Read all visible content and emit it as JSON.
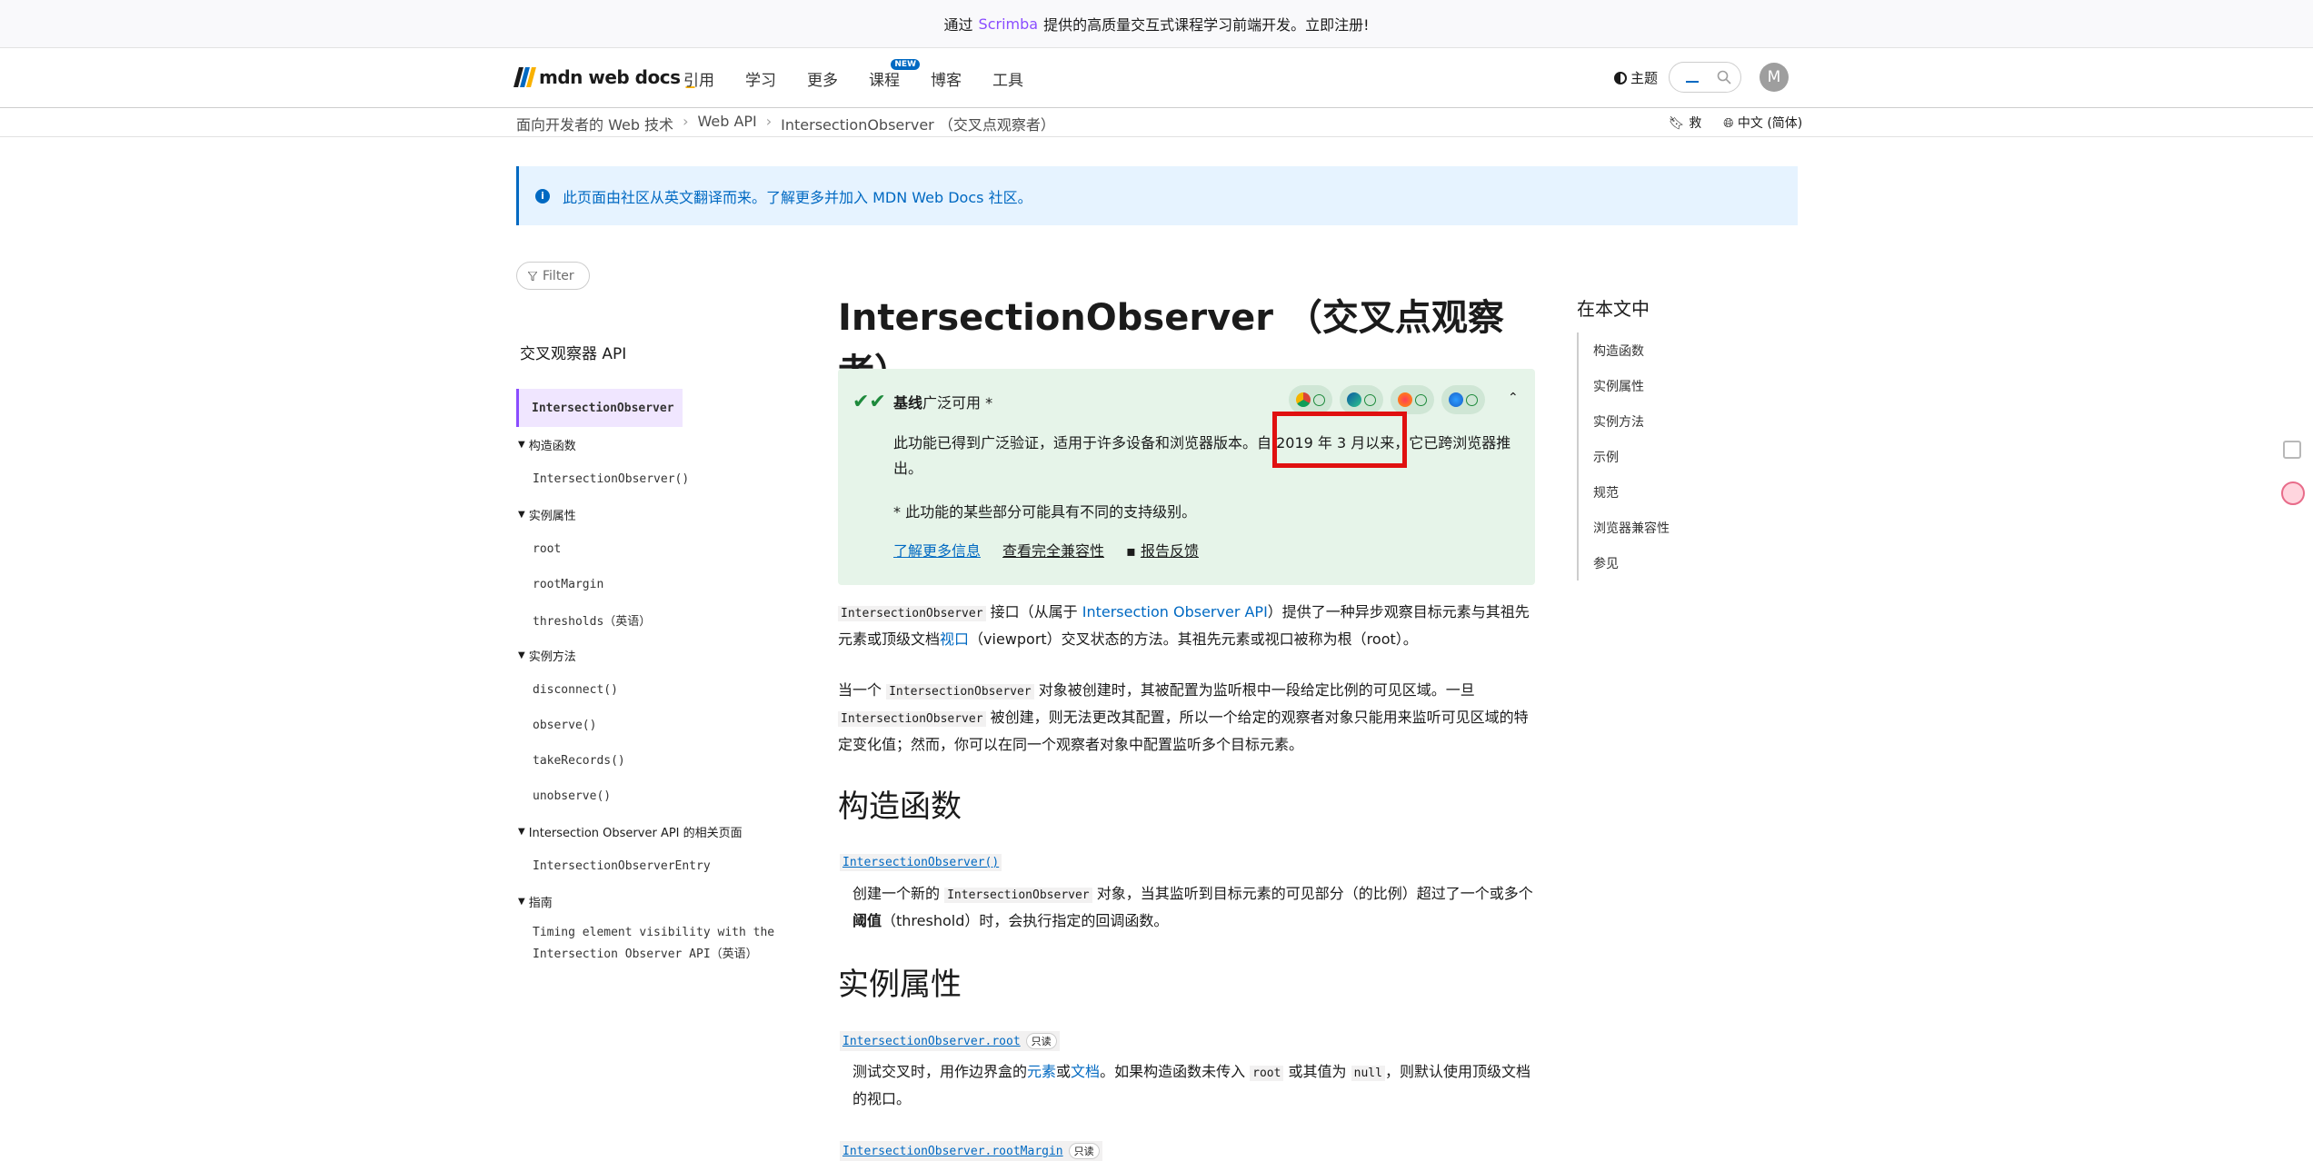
{
  "banner": {
    "pre": "通过",
    "brand": "Scrimba",
    "post": "提供的高质量交互式课程学习前端开发。立即注册!"
  },
  "header": {
    "logo": "mdn web docs",
    "nav": [
      "引用",
      "学习",
      "更多",
      "课程",
      "博客",
      "工具"
    ],
    "new_badge": "NEW",
    "theme": "主题",
    "avatar": "M"
  },
  "breadcrumb": {
    "items": [
      "面向开发者的 Web 技术",
      "Web API",
      "IntersectionObserver （交叉点观察者）"
    ],
    "save": "救",
    "lang": "中文 (简体)"
  },
  "notice": "此页面由社区从英文翻译而来。了解更多并加入 MDN Web Docs 社区。",
  "sidebar": {
    "filter": "Filter",
    "title": "交叉观察器 API",
    "active": "IntersectionObserver",
    "groups": [
      {
        "label": "构造函数",
        "items": [
          "IntersectionObserver()"
        ]
      },
      {
        "label": "实例属性",
        "items": [
          "root",
          "rootMargin",
          "thresholds（英语）"
        ]
      },
      {
        "label": "实例方法",
        "items": [
          "disconnect()",
          "observe()",
          "takeRecords()",
          "unobserve()"
        ]
      },
      {
        "label": "Intersection Observer API 的相关页面",
        "items": [
          "IntersectionObserverEntry"
        ]
      },
      {
        "label": "指南",
        "items": [
          "Timing element visibility with the Intersection Observer API（英语）"
        ]
      }
    ]
  },
  "main": {
    "title": "IntersectionObserver （交叉点观察者）",
    "baseline": {
      "title": "基线",
      "title_rest": "广泛可用 *",
      "desc": "此功能已得到广泛验证，适用于许多设备和浏览器版本。自 2019 年 3 月以来，它已跨浏览器推出。",
      "star": "* 此功能的某些部分可能具有不同的支持级别。",
      "links": [
        "了解更多信息",
        "查看完全兼容性",
        "报告反馈"
      ]
    },
    "intro1": {
      "code": "IntersectionObserver",
      "a": " 接口（从属于 ",
      "link": "Intersection Observer API",
      "b": "）提供了一种异步观察目标元素与其祖先元素或顶级文档",
      "link2": "视口",
      "c": "（viewport）交叉状态的方法。其祖先元素或视口被称为根（root）。"
    },
    "intro2": {
      "a": "当一个 ",
      "code1": "IntersectionObserver",
      "b": " 对象被创建时，其被配置为监听根中一段给定比例的可见区域。一旦 ",
      "code2": "IntersectionObserver",
      "c": " 被创建，则无法更改其配置，所以一个给定的观察者对象只能用来监听可见区域的特定变化值；然而，你可以在同一个观察者对象中配置监听多个目标元素。"
    },
    "h_ctor": "构造函数",
    "ctor_term": "IntersectionObserver()",
    "ctor_desc": {
      "a": "创建一个新的 ",
      "code": "IntersectionObserver",
      "b": " 对象，当其监听到目标元素的可见部分（的比例）超过了一个或多个",
      "bold": "阈值",
      "c": "（threshold）时，会执行指定的回调函数。"
    },
    "h_props": "实例属性",
    "root_term": "IntersectionObserver.root",
    "readonly": "只读",
    "root_desc": {
      "a": "测试交叉时，用作边界盒的",
      "l1": "元素",
      "m": "或",
      "l2": "文档",
      "b": "。如果构造函数未传入 ",
      "code1": "root",
      "c": " 或其值为 ",
      "code2": "null",
      "d": "，则默认使用顶级文档的视口。"
    },
    "margin_term": "IntersectionObserver.rootMargin"
  },
  "toc": {
    "title": "在本文中",
    "items": [
      "构造函数",
      "实例属性",
      "实例方法",
      "示例",
      "规范",
      "浏览器兼容性",
      "参见"
    ]
  }
}
